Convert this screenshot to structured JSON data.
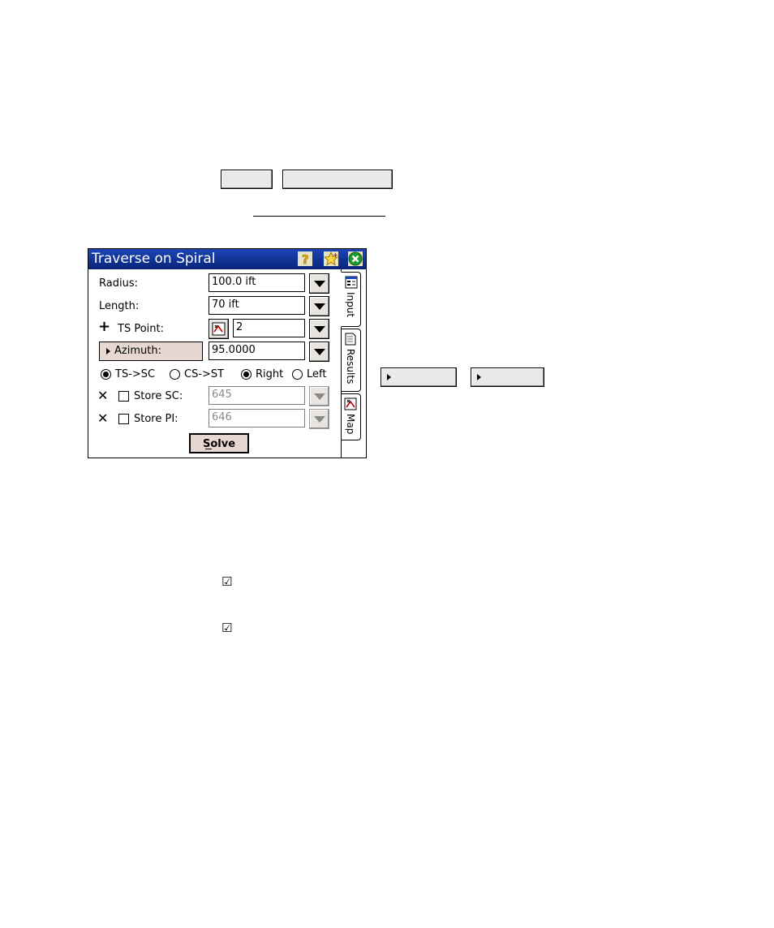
{
  "window": {
    "title": "Traverse on Spiral",
    "titlebar_icons": [
      "help-icon",
      "favorites-star-icon",
      "close-icon"
    ]
  },
  "form": {
    "radius": {
      "label": "Radius:",
      "value": "100.0 ift"
    },
    "length": {
      "label": "Length:",
      "value": "70 ift"
    },
    "ts_point": {
      "label": "TS Point:",
      "value": "2"
    },
    "azimuth": {
      "label": "Azimuth:",
      "value": "95.0000"
    },
    "direction_options": [
      {
        "label": "TS->SC",
        "selected": true
      },
      {
        "label": "CS->ST",
        "selected": false
      }
    ],
    "side_options": [
      {
        "label": "Right",
        "selected": true
      },
      {
        "label": "Left",
        "selected": false
      }
    ],
    "store_sc": {
      "label": "Store SC:",
      "value": "645",
      "checked": false
    },
    "store_pi": {
      "label": "Store PI:",
      "value": "646",
      "checked": false
    },
    "solve_label": "Solve"
  },
  "tabs": [
    {
      "label": "Input",
      "icon": "input-tab-icon",
      "active": true
    },
    {
      "label": "Results",
      "icon": "results-tab-icon",
      "active": false
    },
    {
      "label": "Map",
      "icon": "map-tab-icon",
      "active": false
    }
  ],
  "document": {
    "checkmark_glyph": "☑"
  }
}
